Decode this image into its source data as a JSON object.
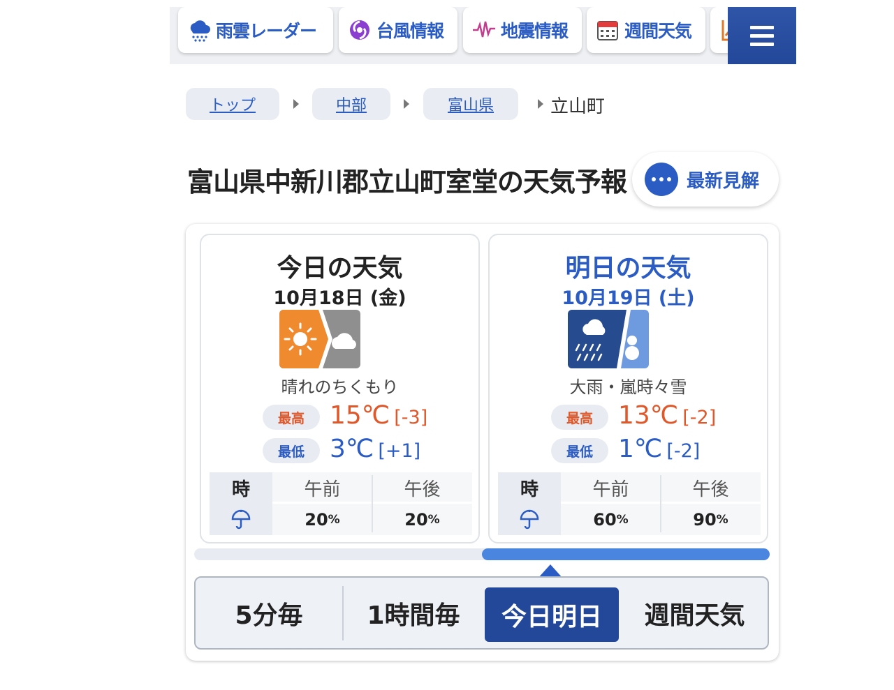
{
  "nav": {
    "items": [
      {
        "label": "雨雲レーダー",
        "icon": "rain-cloud-icon"
      },
      {
        "label": "台風情報",
        "icon": "typhoon-icon"
      },
      {
        "label": "地震情報",
        "icon": "seismograph-icon"
      },
      {
        "label": "週間天気",
        "icon": "calendar-icon"
      }
    ],
    "menu_icon": "hamburger-menu-icon"
  },
  "breadcrumb": {
    "items": [
      "トップ",
      "中部",
      "富山県"
    ],
    "current": "立山町"
  },
  "page": {
    "title": "富山県中新川郡立山町室堂の天気予報",
    "latest_label": "最新見解"
  },
  "forecast": {
    "days": [
      {
        "title": "今日の天気",
        "date": "10月18日 (金)",
        "weather": "晴れのちくもり",
        "icon": "sun-then-cloud-icon",
        "high_label": "最高",
        "high": "15℃",
        "high_diff": "[-3]",
        "low_label": "最低",
        "low": "3℃",
        "low_diff": "[+1]",
        "table": {
          "hour_label": "時",
          "am": "午前",
          "pm": "午後",
          "am_pop": "20",
          "pm_pop": "20",
          "unit": "%"
        }
      },
      {
        "title": "明日の天気",
        "date": "10月19日 (土)",
        "weather": "大雨・嵐時々雪",
        "icon": "heavy-rain-snow-icon",
        "high_label": "最高",
        "high": "13℃",
        "high_diff": "[-2]",
        "low_label": "最低",
        "low": "1℃",
        "low_diff": "[-2]",
        "table": {
          "hour_label": "時",
          "am": "午前",
          "pm": "午後",
          "am_pop": "60",
          "pm_pop": "90",
          "unit": "%"
        }
      }
    ],
    "slider_position": 0.5
  },
  "tabs": {
    "items": [
      "5分毎",
      "1時間毎",
      "今日明日",
      "週間天気"
    ],
    "active": "今日明日"
  },
  "colors": {
    "accent": "#2b5cc4",
    "high": "#e0582a",
    "active_tab": "#23489a"
  }
}
